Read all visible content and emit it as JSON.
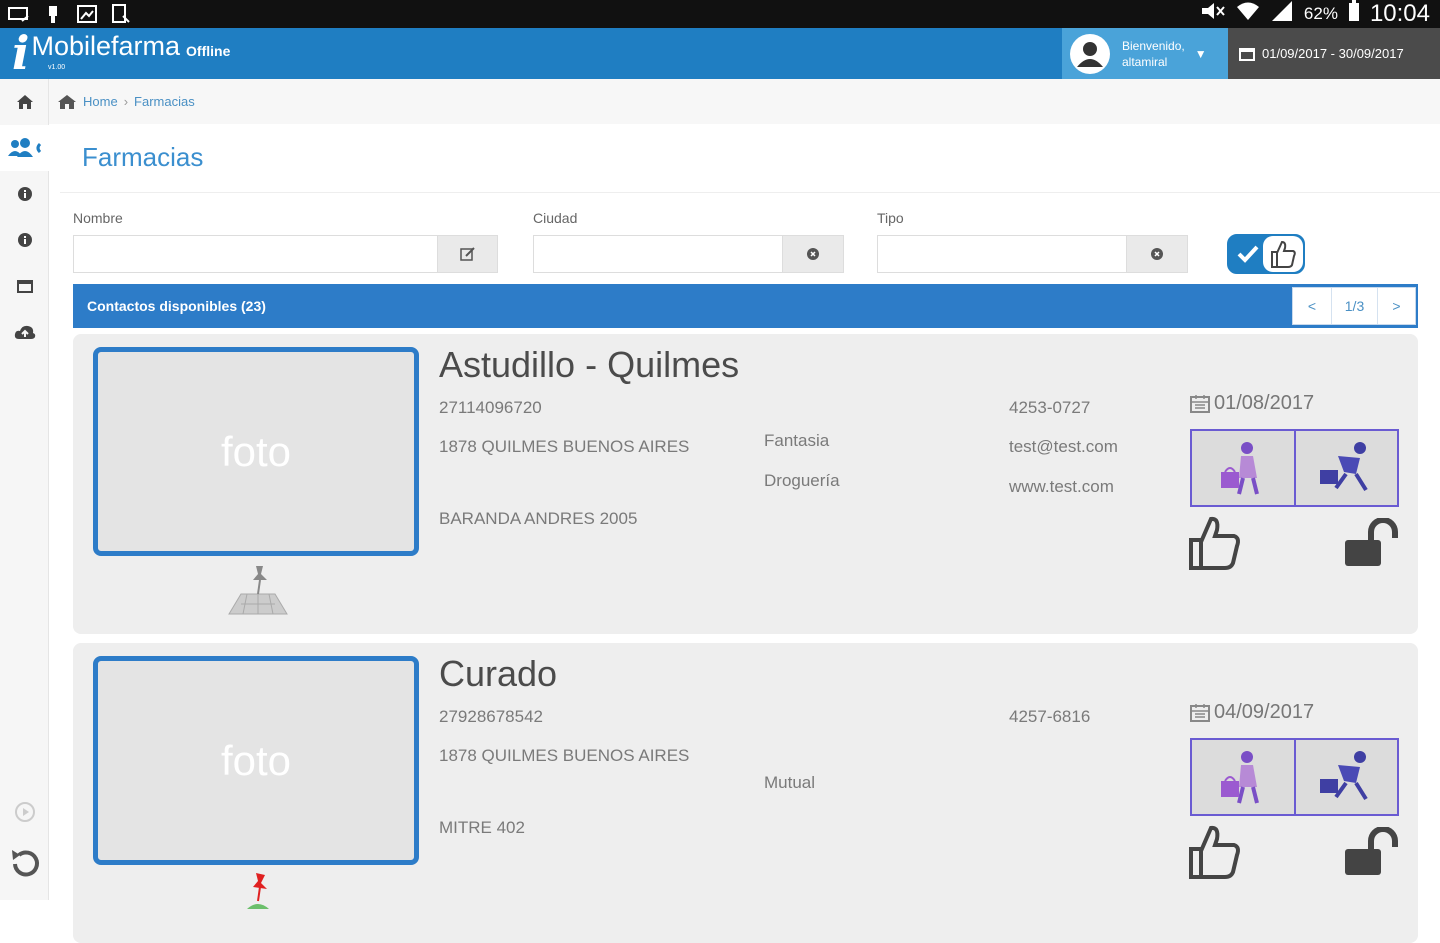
{
  "status_bar": {
    "battery_pct": "62%",
    "time": "10:04"
  },
  "app": {
    "logo_letter": "i",
    "name": "Mobilefarma",
    "mode": "Offline",
    "version": "v1.00"
  },
  "user": {
    "welcome_line1": "Bienvenido,",
    "welcome_line2": "altamiral"
  },
  "date_range": "01/09/2017 - 30/09/2017",
  "breadcrumb": {
    "home": "Home",
    "sep": "›",
    "current": "Farmacias"
  },
  "page_title": "Farmacias",
  "filters": {
    "nombre_label": "Nombre",
    "ciudad_label": "Ciudad",
    "tipo_label": "Tipo",
    "nombre_value": "",
    "ciudad_value": "",
    "tipo_value": ""
  },
  "list": {
    "header": "Contactos disponibles (23)",
    "prev": "<",
    "page": "1/3",
    "next": ">"
  },
  "cards": [
    {
      "photo_label": "foto",
      "name": "Astudillo - Quilmes",
      "id": "27114096720",
      "city": "1878 QUILMES BUENOS AIRES",
      "address": "BARANDA ANDRES 2005",
      "type1": "Fantasia",
      "type2": "Droguería",
      "phone": "4253-0727",
      "email": "test@test.com",
      "web": "www.test.com",
      "date": "01/08/2017"
    },
    {
      "photo_label": "foto",
      "name": "Curado",
      "id": "27928678542",
      "city": "1878 QUILMES BUENOS AIRES",
      "address": "MITRE 402",
      "type1": "Mutual",
      "phone": "4257-6816",
      "date": "04/09/2017"
    }
  ],
  "colors": {
    "brand": "#1f7ec2",
    "list_header": "#2d7cc8",
    "action_border": "#6a5bd2"
  }
}
